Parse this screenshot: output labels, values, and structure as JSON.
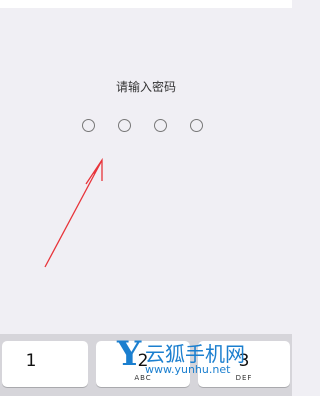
{
  "lock_screen": {
    "prompt": "请输入密码",
    "passcode_length": 4
  },
  "keypad": {
    "keys": [
      {
        "digit": "1",
        "letters": ""
      },
      {
        "digit": "2",
        "letters": "ABC"
      },
      {
        "digit": "3",
        "letters": "DEF"
      }
    ]
  },
  "annotation": {
    "type": "arrow",
    "color": "#e8343a"
  },
  "watermark": {
    "logo_letter": "Y",
    "title": "云狐手机网",
    "url": "www.yunhu.net"
  },
  "colors": {
    "background": "#f0eff4",
    "keypad": "#d6d5da",
    "key": "#ffffff",
    "watermark": "#1b7fcf"
  }
}
